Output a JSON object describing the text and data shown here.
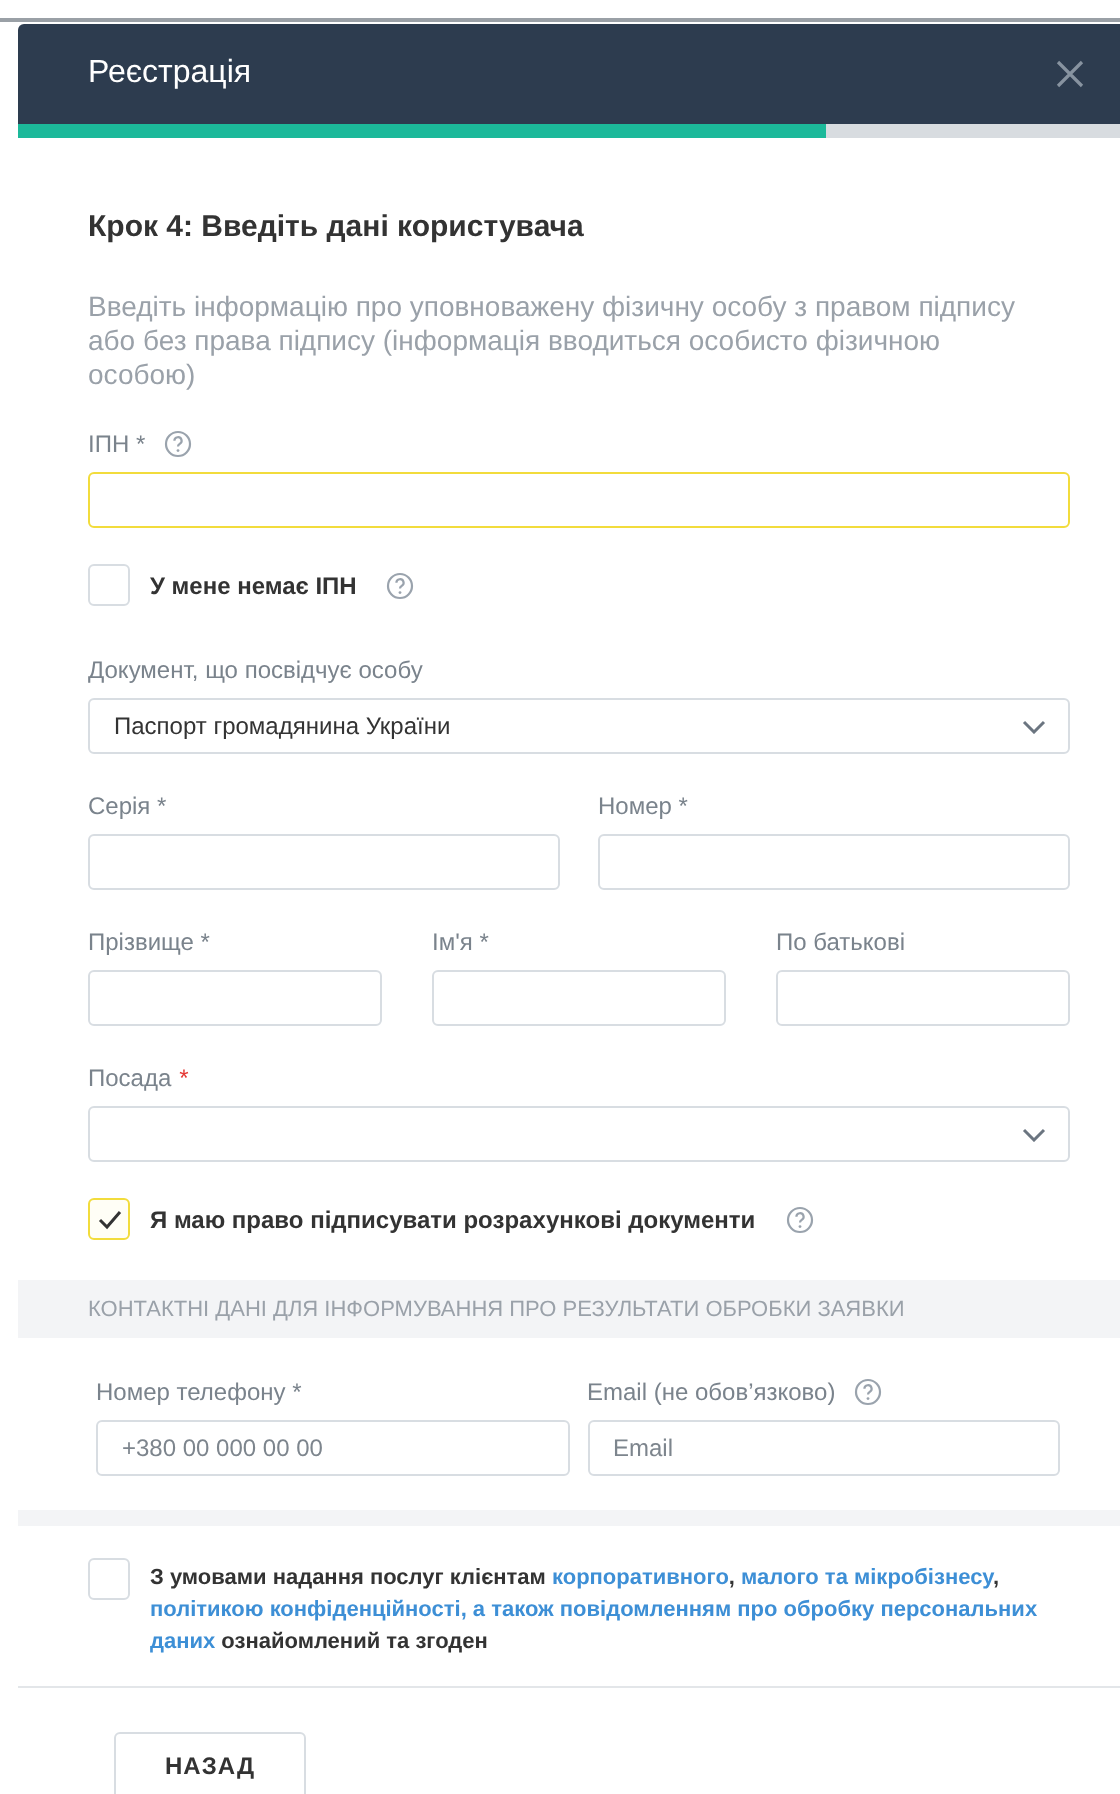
{
  "window": {
    "title": "Реєстрація"
  },
  "progress": {
    "level": 0.733
  },
  "step_title": "Крок 4: Введіть дані користувача",
  "description": "Введіть інформацію про уповноважену фізичну особу з правом підпису або без права підпису (інформація вводиться особисто фізичною особою)",
  "form": [
    {
      "kind": "fields",
      "fields": [
        {
          "kind": "input",
          "label": "ІПН *",
          "help": true,
          "focused": true
        }
      ]
    },
    {
      "kind": "checkbox",
      "label": "У мене немає ІПН",
      "checked": false,
      "help": true
    },
    {
      "kind": "fields",
      "fields": [
        {
          "kind": "select",
          "label": "Документ, що посвідчує особу",
          "value": "Паспорт громадянина України",
          "help": false,
          "focused": false
        }
      ]
    },
    {
      "kind": "fields",
      "fields": [
        {
          "kind": "input",
          "label": "Серія *",
          "help": false,
          "focused": false
        },
        {
          "kind": "input",
          "label": "Номер *",
          "help": false,
          "focused": false
        }
      ]
    },
    {
      "kind": "fields",
      "fields": [
        {
          "kind": "input",
          "label": "Прізвище *",
          "help": false,
          "focused": false
        },
        {
          "kind": "input",
          "label": "Ім'я *",
          "help": false,
          "focused": false
        },
        {
          "kind": "input",
          "label": "По батькові",
          "help": false,
          "focused": false
        }
      ]
    },
    {
      "kind": "fields",
      "fields": [
        {
          "kind": "select",
          "label": "Посада",
          "required_mark": "*",
          "help": false,
          "focused": false
        }
      ]
    },
    {
      "kind": "checkbox",
      "label": "Я маю право підписувати розрахункові документи",
      "checked": true,
      "help": true
    }
  ],
  "contacts": {
    "title": "КОНТАКТНІ ДАНІ ДЛЯ ІНФОРМУВАННЯ ПРО РЕЗУЛЬТАТИ ОБРОБКИ ЗАЯВКИ",
    "fields": [
      {
        "kind": "input",
        "label": "Номер телефону *",
        "placeholder": "+380 00 000 00 00",
        "help": false,
        "focused": false
      },
      {
        "kind": "input",
        "label": "Email (не обов’язково)",
        "placeholder": "Email",
        "help": true,
        "focused": false
      }
    ]
  },
  "consent": {
    "checked": false,
    "parts": [
      {
        "kind": "text",
        "text": "З умовами надання послуг клієнтам "
      },
      {
        "kind": "link",
        "text": "корпоративного"
      },
      {
        "kind": "text",
        "text": ", "
      },
      {
        "kind": "link",
        "text": "малого та мікробізнесу"
      },
      {
        "kind": "text",
        "text": ", "
      },
      {
        "kind": "link",
        "text": "політикою конфіденційності, а також повідомленням про обробку персональних"
      },
      {
        "kind": "link",
        "text": "даних"
      },
      {
        "kind": "text",
        "text": " ознайомлений та згоден"
      }
    ]
  },
  "buttons": [
    {
      "label": "НАЗАД"
    }
  ]
}
